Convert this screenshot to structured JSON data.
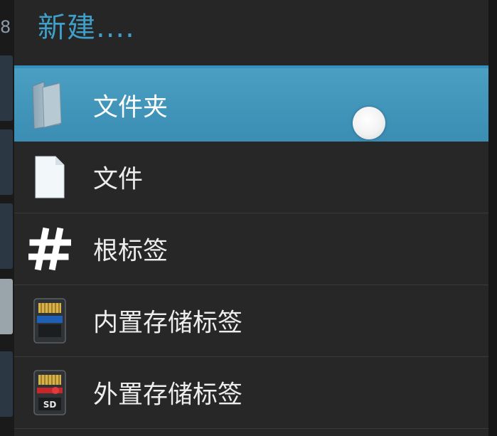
{
  "background": {
    "tab_digit": "8"
  },
  "dialog": {
    "title": "新建....",
    "items": [
      {
        "label": "文件夹",
        "icon": "folder-icon",
        "selected": true
      },
      {
        "label": "文件",
        "icon": "file-icon",
        "selected": false
      },
      {
        "label": "根标签",
        "icon": "hash-icon",
        "selected": false
      },
      {
        "label": "内置存储标签",
        "icon": "internal-storage-icon",
        "selected": false
      },
      {
        "label": "外置存储标签",
        "icon": "sd-card-icon",
        "selected": false
      }
    ]
  },
  "colors": {
    "accent": "#3f9fc8",
    "selected_row": "#3b8db3",
    "dialog_bg": "#272727"
  }
}
